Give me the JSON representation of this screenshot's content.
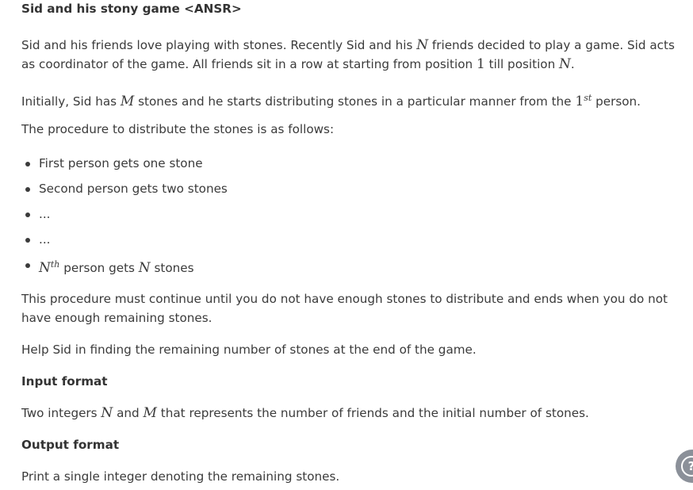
{
  "title": "Sid and his stony game <ANSR>",
  "p1": {
    "a": "Sid and his friends love playing with stones. Recently Sid and his ",
    "N": "N",
    "b": " friends decided to play a game. Sid acts as coordinator of the game. All friends sit in a row at starting from position ",
    "one": "1",
    "c": " till position ",
    "N2": "N",
    "d": "."
  },
  "p2": {
    "a": "Initially, Sid has ",
    "M": "M",
    "b": " stones and he starts distributing stones in a particular manner from the ",
    "one": "1",
    "sup": "st",
    "c": " person."
  },
  "p3": "The procedure to distribute the stones is as follows:",
  "list": {
    "i0": "First person gets one stone",
    "i1": "Second person gets two stones",
    "i2": "...",
    "i3": "...",
    "i4_N": "N",
    "i4_sup": "th",
    "i4_a": " person gets ",
    "i4_N2": "N",
    "i4_b": " stones"
  },
  "p4": "This procedure must continue until you do not have enough stones to distribute and ends when you do not have enough remaining stones.",
  "p5": "Help Sid in finding the remaining number of stones at the end of the game.",
  "input_heading": "Input format",
  "input": {
    "a": "Two integers ",
    "N": "N",
    "b": " and ",
    "M": "M",
    "c": " that represents the number of friends and the initial number of stones."
  },
  "output_heading": "Output format",
  "output": "Print a single integer denoting the remaining stones.",
  "help_icon": "?"
}
